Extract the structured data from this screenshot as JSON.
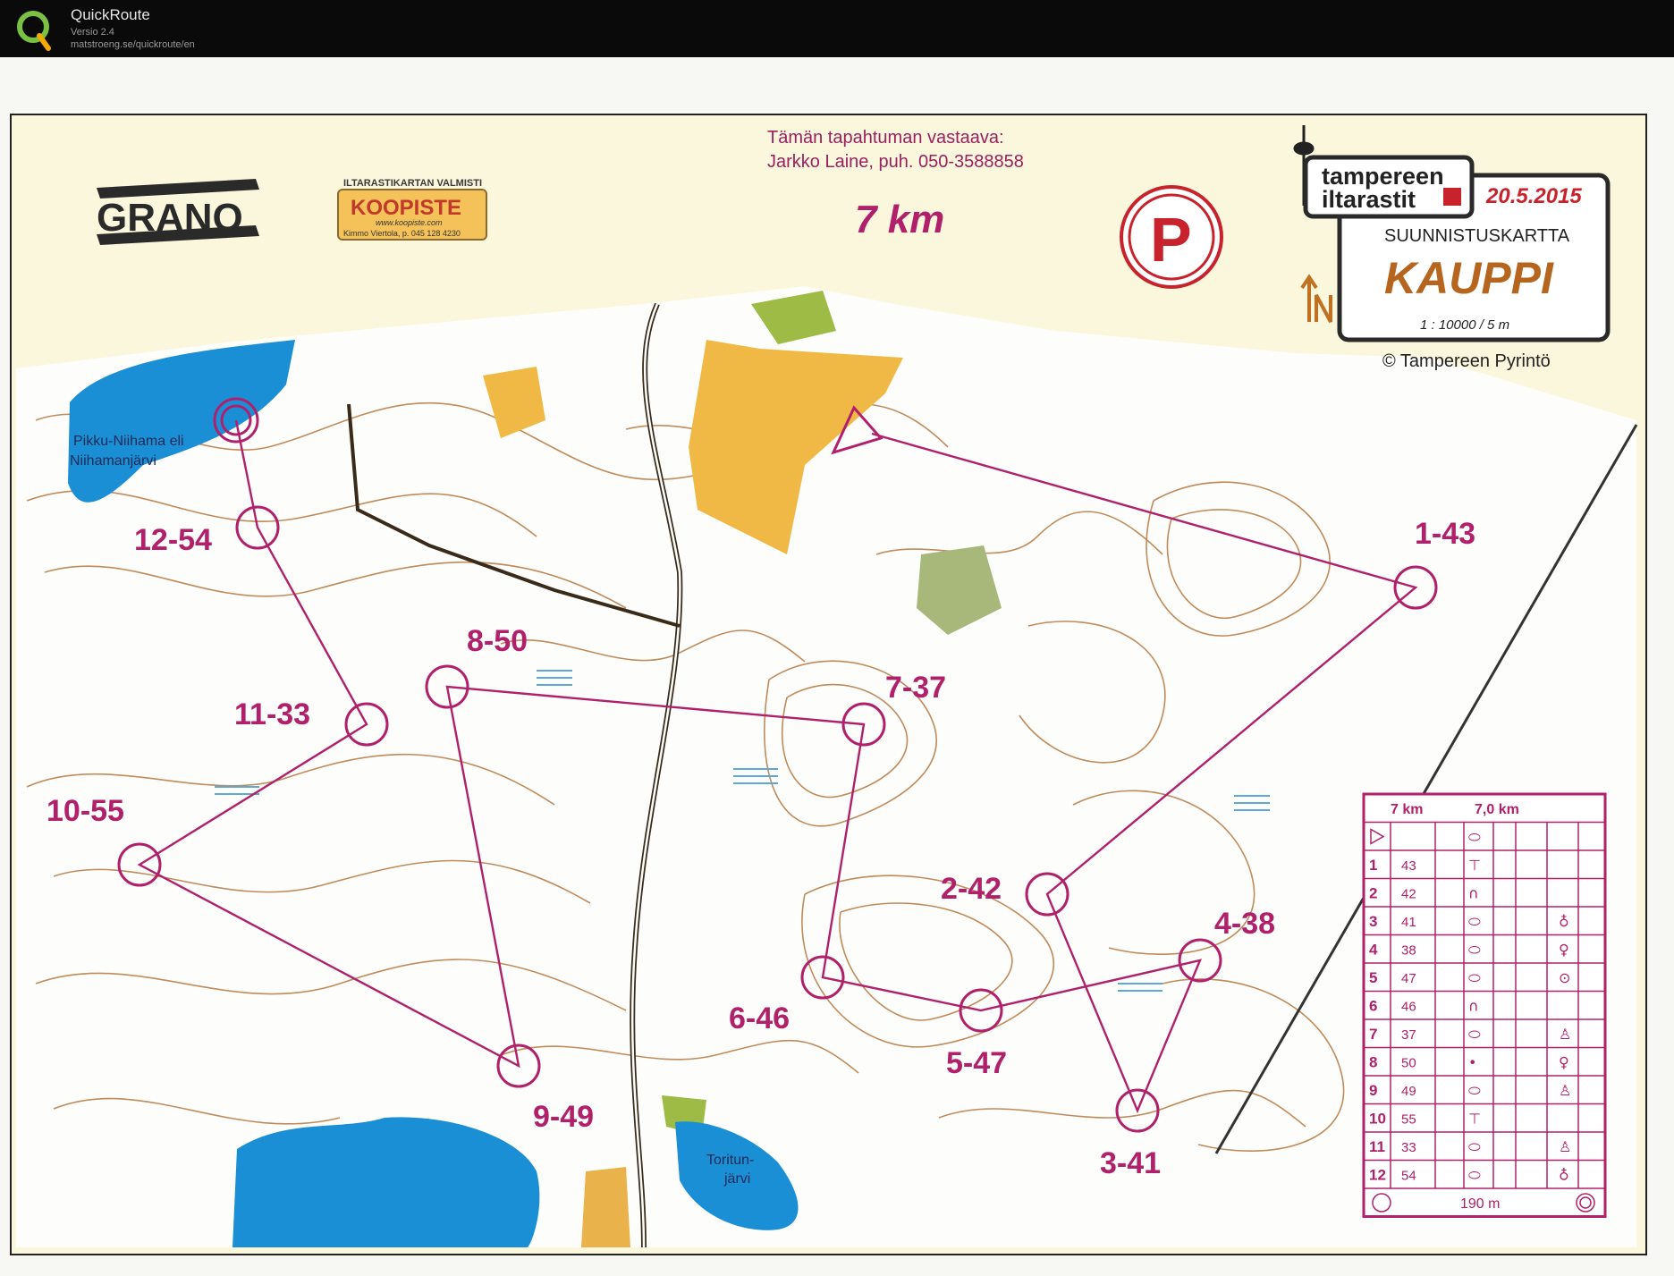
{
  "app": {
    "name": "QuickRoute",
    "version": "Versio 2.4",
    "url": "matstroeng.se/quickroute/en"
  },
  "map": {
    "contact_line1": "Tämän tapahtuman vastaava:",
    "contact_line2": "Jarkko Laine, puh. 050-3588858",
    "course_length": "7 km",
    "sponsor_grano": "GRANO",
    "koopiste_top": "ILTARASTIKARTAN VALMISTI",
    "koopiste_name": "KOOPISTE",
    "koopiste_web": "www.koopiste.com",
    "koopiste_contact": "Kimmo Viertola, p. 045 128 4230",
    "parking": "P",
    "brand_line1": "tampereen",
    "brand_line2": "iltarastit",
    "date": "20.5.2015",
    "map_type": "SUUNNISTUSKARTTA",
    "map_name": "KAUPPI",
    "scale": "1 : 10000 / 5 m",
    "copyright": "© Tampereen Pyrintö",
    "lake1_line1": "Pikku-Niihama eli",
    "lake1_line2": "Niihamanjärvi",
    "lake2_line1": "Toritun-",
    "lake2_line2": "järvi"
  },
  "controls": [
    {
      "label": "1-43"
    },
    {
      "label": "2-42"
    },
    {
      "label": "3-41"
    },
    {
      "label": "4-38"
    },
    {
      "label": "5-47"
    },
    {
      "label": "6-46"
    },
    {
      "label": "7-37"
    },
    {
      "label": "8-50"
    },
    {
      "label": "9-49"
    },
    {
      "label": "10-55"
    },
    {
      "label": "11-33"
    },
    {
      "label": "12-54"
    }
  ],
  "description_sheet": {
    "header_course": "7 km",
    "header_length": "7,0 km",
    "rows": [
      {
        "num": "1",
        "code": "43",
        "symbol": "⊤",
        "extra": ""
      },
      {
        "num": "2",
        "code": "42",
        "symbol": "∩",
        "extra": ""
      },
      {
        "num": "3",
        "code": "41",
        "symbol": "⬭",
        "extra": "♁"
      },
      {
        "num": "4",
        "code": "38",
        "symbol": "⬭",
        "extra": "♀"
      },
      {
        "num": "5",
        "code": "47",
        "symbol": "⬭",
        "extra": "⊙"
      },
      {
        "num": "6",
        "code": "46",
        "symbol": "∩",
        "extra": ""
      },
      {
        "num": "7",
        "code": "37",
        "symbol": "⬭",
        "extra": "♙"
      },
      {
        "num": "8",
        "code": "50",
        "symbol": "•",
        "extra": "♀"
      },
      {
        "num": "9",
        "code": "49",
        "symbol": "⬭",
        "extra": "♙"
      },
      {
        "num": "10",
        "code": "55",
        "symbol": "⊤",
        "extra": ""
      },
      {
        "num": "11",
        "code": "33",
        "symbol": "⬭",
        "extra": "♙"
      },
      {
        "num": "12",
        "code": "54",
        "symbol": "⬭",
        "extra": "♁"
      }
    ],
    "finish_distance": "190 m"
  }
}
